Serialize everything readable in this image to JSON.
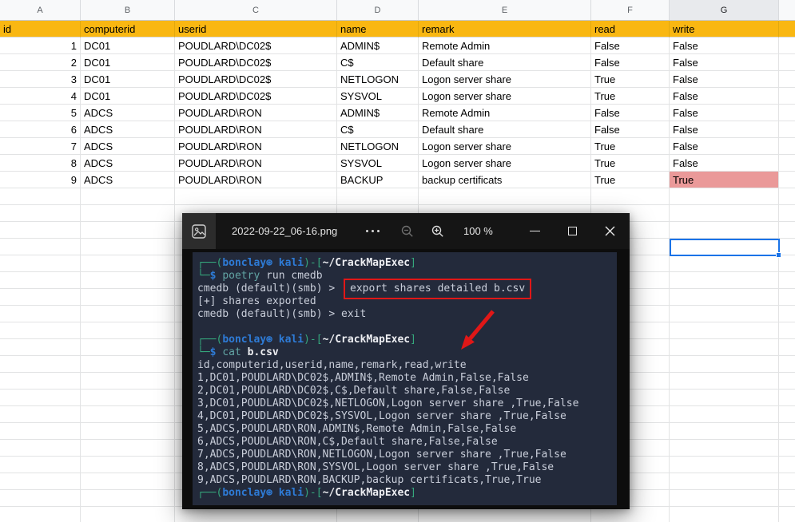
{
  "spreadsheet": {
    "column_letters": [
      "A",
      "B",
      "C",
      "D",
      "E",
      "F",
      "G"
    ],
    "selected_column": "G",
    "header_row": [
      "id",
      "computerid",
      "userid",
      "name",
      "remark",
      "read",
      "write"
    ],
    "rows": [
      [
        "1",
        "DC01",
        "POUDLARD\\DC02$",
        "ADMIN$",
        "Remote Admin",
        "False",
        "False"
      ],
      [
        "2",
        "DC01",
        "POUDLARD\\DC02$",
        "C$",
        "Default share",
        "False",
        "False"
      ],
      [
        "3",
        "DC01",
        "POUDLARD\\DC02$",
        "NETLOGON",
        "Logon server share",
        "True",
        "False"
      ],
      [
        "4",
        "DC01",
        "POUDLARD\\DC02$",
        "SYSVOL",
        "Logon server share",
        "True",
        "False"
      ],
      [
        "5",
        "ADCS",
        "POUDLARD\\RON",
        "ADMIN$",
        "Remote Admin",
        "False",
        "False"
      ],
      [
        "6",
        "ADCS",
        "POUDLARD\\RON",
        "C$",
        "Default share",
        "False",
        "False"
      ],
      [
        "7",
        "ADCS",
        "POUDLARD\\RON",
        "NETLOGON",
        "Logon server share",
        "True",
        "False"
      ],
      [
        "8",
        "ADCS",
        "POUDLARD\\RON",
        "SYSVOL",
        "Logon server share",
        "True",
        "False"
      ],
      [
        "9",
        "ADCS",
        "POUDLARD\\RON",
        "BACKUP",
        "backup certificats",
        "True",
        "True"
      ]
    ],
    "colors": {
      "header_fill": "#F9B712",
      "highlight_fill": "#EA9999",
      "selection_border": "#1A73E8"
    }
  },
  "viewer": {
    "title": "2022-09-22_06-16.png",
    "zoom_level": "100 %",
    "icons": [
      "image-icon",
      "more-options-icon",
      "zoom-out-icon",
      "zoom-in-icon",
      "minimize-icon",
      "maximize-icon",
      "close-icon"
    ]
  },
  "terminal": {
    "lines": [
      {
        "seg": [
          [
            "f",
            "┌──("
          ],
          [
            "u",
            "bonclay"
          ],
          [
            "u",
            "⊛ "
          ],
          [
            "u",
            "kali"
          ],
          [
            "f",
            ")-["
          ],
          [
            "p",
            "~/CrackMapExec"
          ],
          [
            "f",
            "]"
          ]
        ]
      },
      {
        "seg": [
          [
            "f",
            "└─"
          ],
          [
            "d",
            "$ "
          ],
          [
            "c",
            "poetry"
          ],
          [
            "o",
            " run cmedb"
          ]
        ]
      },
      {
        "seg": [
          [
            "o",
            "cmedb (default)(smb) > "
          ],
          [
            "boxed",
            "export shares detailed b.csv"
          ]
        ]
      },
      {
        "seg": [
          [
            "o",
            "[+] shares exported"
          ]
        ]
      },
      {
        "seg": [
          [
            "o",
            "cmedb (default)(smb) > exit"
          ]
        ]
      },
      {
        "seg": [
          [
            "o",
            " "
          ]
        ]
      },
      {
        "seg": [
          [
            "f",
            "┌──("
          ],
          [
            "u",
            "bonclay"
          ],
          [
            "u",
            "⊛ "
          ],
          [
            "u",
            "kali"
          ],
          [
            "f",
            ")-["
          ],
          [
            "p",
            "~/CrackMapExec"
          ],
          [
            "f",
            "]"
          ]
        ]
      },
      {
        "seg": [
          [
            "f",
            "└─"
          ],
          [
            "d",
            "$ "
          ],
          [
            "c",
            "cat"
          ],
          [
            "p",
            " b.csv"
          ]
        ]
      },
      {
        "seg": [
          [
            "o",
            "id,computerid,userid,name,remark,read,write"
          ]
        ]
      },
      {
        "seg": [
          [
            "o",
            "1,DC01,POUDLARD\\DC02$,ADMIN$,Remote Admin,False,False"
          ]
        ]
      },
      {
        "seg": [
          [
            "o",
            "2,DC01,POUDLARD\\DC02$,C$,Default share,False,False"
          ]
        ]
      },
      {
        "seg": [
          [
            "o",
            "3,DC01,POUDLARD\\DC02$,NETLOGON,Logon server share ,True,False"
          ]
        ]
      },
      {
        "seg": [
          [
            "o",
            "4,DC01,POUDLARD\\DC02$,SYSVOL,Logon server share ,True,False"
          ]
        ]
      },
      {
        "seg": [
          [
            "o",
            "5,ADCS,POUDLARD\\RON,ADMIN$,Remote Admin,False,False"
          ]
        ]
      },
      {
        "seg": [
          [
            "o",
            "6,ADCS,POUDLARD\\RON,C$,Default share,False,False"
          ]
        ]
      },
      {
        "seg": [
          [
            "o",
            "7,ADCS,POUDLARD\\RON,NETLOGON,Logon server share ,True,False"
          ]
        ]
      },
      {
        "seg": [
          [
            "o",
            "8,ADCS,POUDLARD\\RON,SYSVOL,Logon server share ,True,False"
          ]
        ]
      },
      {
        "seg": [
          [
            "o",
            "9,ADCS,POUDLARD\\RON,BACKUP,backup certificats,True,True"
          ]
        ]
      },
      {
        "seg": [
          [
            "f",
            "┌──("
          ],
          [
            "u",
            "bonclay"
          ],
          [
            "u",
            "⊛ "
          ],
          [
            "u",
            "kali"
          ],
          [
            "f",
            ")-["
          ],
          [
            "p",
            "~/CrackMapExec"
          ],
          [
            "f",
            "]"
          ]
        ]
      }
    ]
  },
  "annotations": {
    "color": "#E01717"
  }
}
